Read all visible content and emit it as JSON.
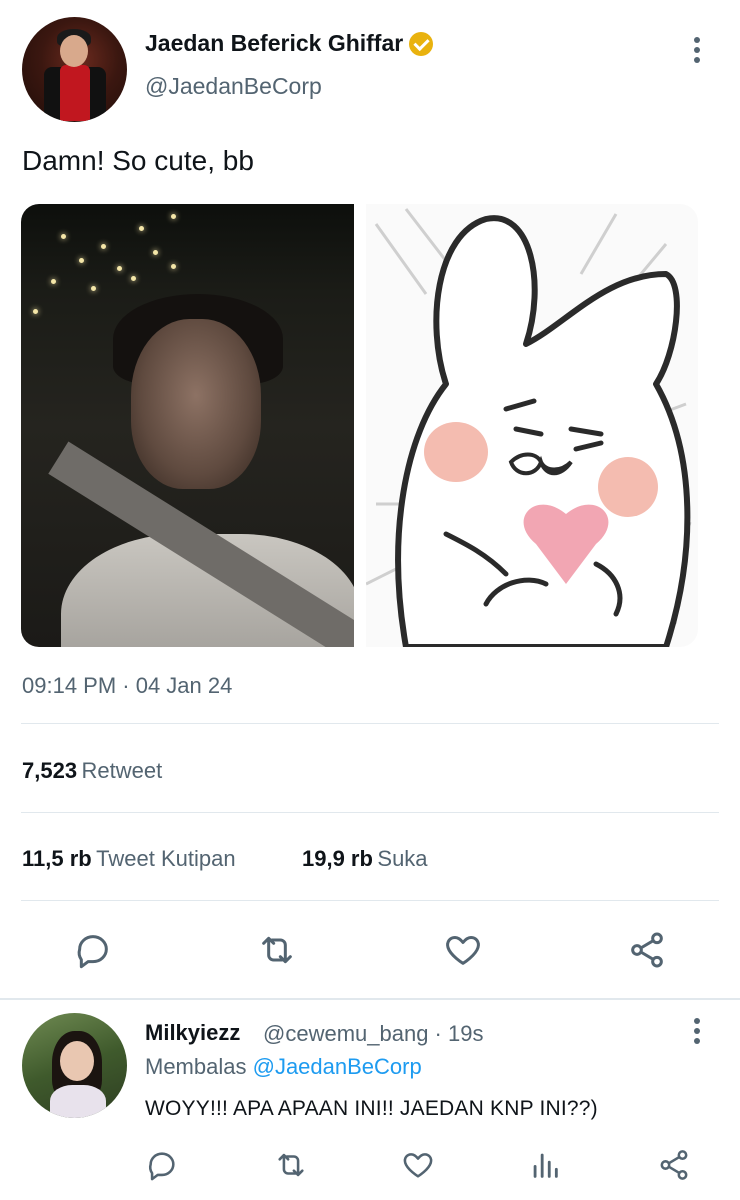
{
  "tweet": {
    "display_name": "Jaedan Beferick Ghiffar",
    "handle": "@JaedanBeCorp",
    "text": "Damn! So cute, bb",
    "timestamp": "09:14 PM · 04 Jan 24",
    "retweets": {
      "count": "7,523",
      "label": "Retweet"
    },
    "quotes": {
      "count": "11,5 rb",
      "label": "Tweet Kutipan"
    },
    "likes": {
      "count": "19,9 rb",
      "label": "Suka"
    },
    "verified_color": "#e9b20e",
    "actions": [
      "reply-icon",
      "retweet-icon",
      "like-icon",
      "share-icon"
    ]
  },
  "reply": {
    "display_name": "Milkyiezz",
    "handle_time": "@cewemu_bang · 19s",
    "replying_prefix": "Membalas",
    "replying_to": "@JaedanBeCorp",
    "text": "WOYY!!! APA APAAN INI!! JAEDAN KNP INI??)",
    "actions": [
      "reply-icon",
      "retweet-icon",
      "like-icon",
      "analytics-icon",
      "share-icon"
    ]
  },
  "colors": {
    "text_primary": "#0f1419",
    "text_secondary": "#536471",
    "link": "#1d9bf0",
    "divider": "#e1e8ed"
  }
}
